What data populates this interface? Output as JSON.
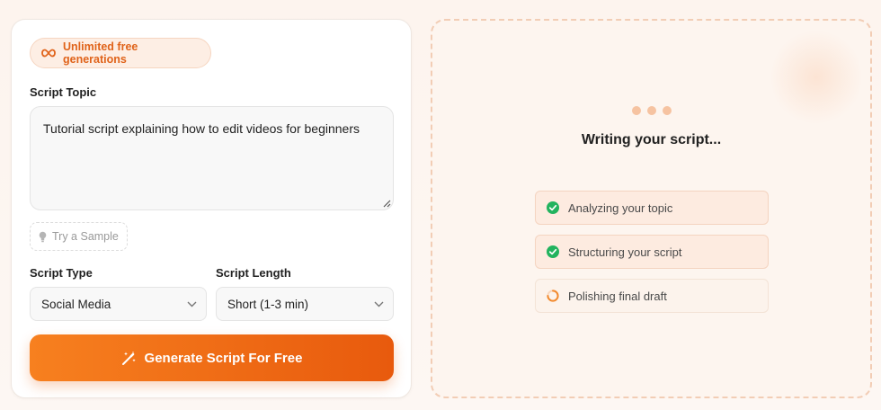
{
  "form": {
    "badge_label": "Unlimited free generations",
    "topic_label": "Script Topic",
    "topic_value": "Tutorial script explaining how to edit videos for beginners",
    "sample_label": "Try a Sample",
    "type_label": "Script Type",
    "type_value": "Social Media",
    "length_label": "Script Length",
    "length_value": "Short (1-3 min)",
    "generate_label": "Generate Script For Free"
  },
  "output": {
    "status_title": "Writing your script...",
    "steps": [
      {
        "label": "Analyzing your topic",
        "state": "done"
      },
      {
        "label": "Structuring your script",
        "state": "done"
      },
      {
        "label": "Polishing final draft",
        "state": "in-progress"
      }
    ]
  },
  "colors": {
    "accent": "#ef6c17",
    "success": "#22b35e",
    "badge_bg": "#fdeee4"
  },
  "icons": {
    "badge": "infinity-icon",
    "sample": "lightbulb-icon",
    "dropdown": "chevron-down-icon",
    "generate": "magic-wand-icon",
    "done": "check-circle-icon",
    "in_progress": "spinner-icon"
  }
}
